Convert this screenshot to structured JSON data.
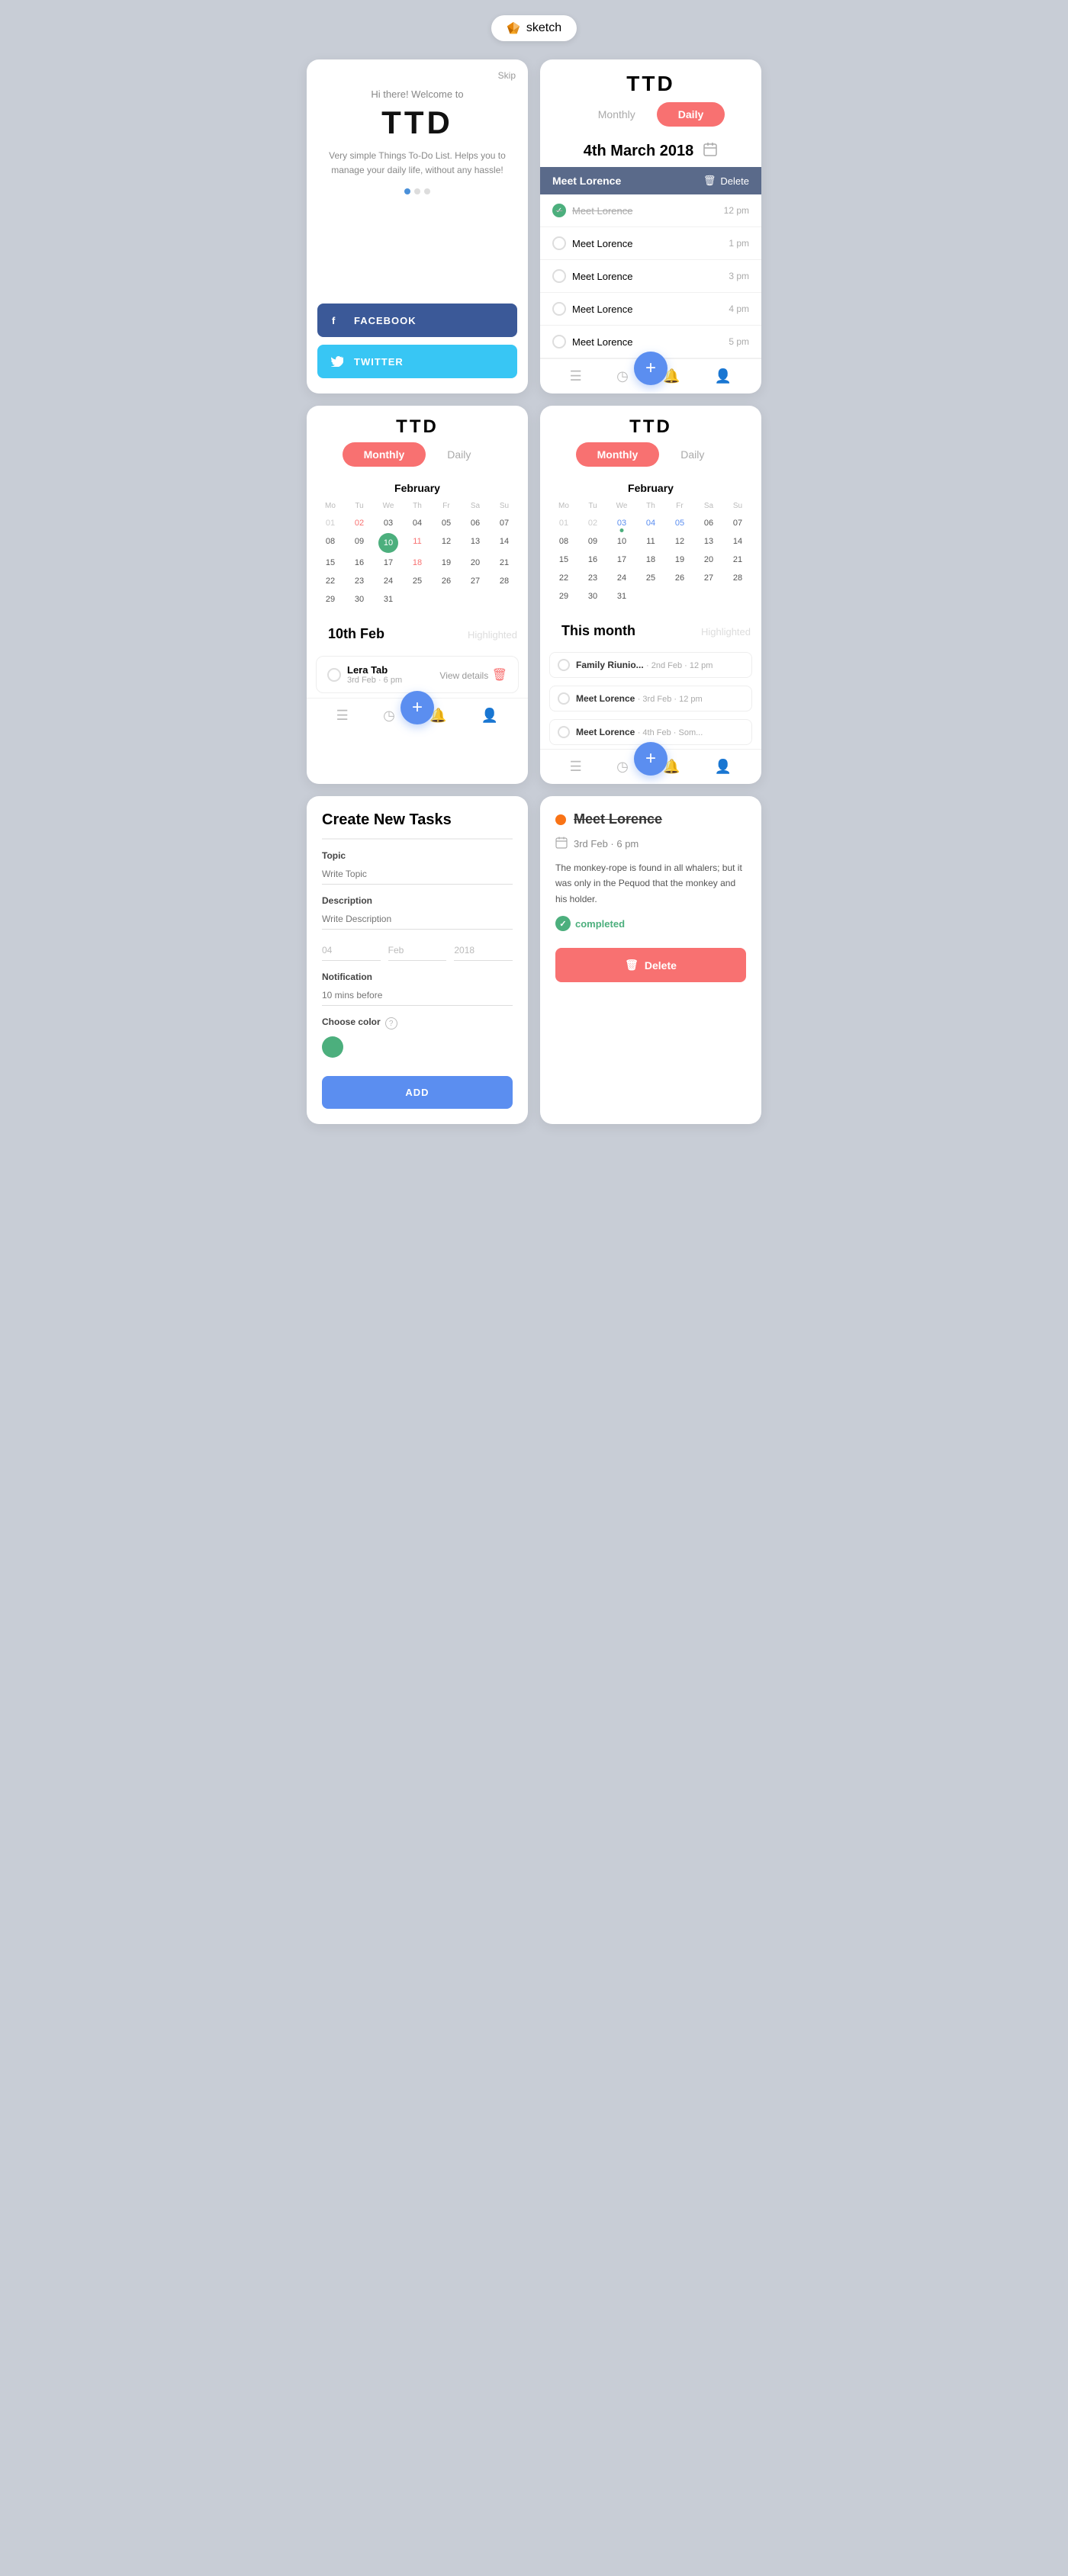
{
  "topbar": {
    "label": "sketch",
    "icon": "◆"
  },
  "card_welcome": {
    "skip_label": "Skip",
    "hi_text": "Hi there! Welcome to",
    "ttd_logo": "TTD",
    "desc": "Very simple Things To-Do List. Helps you to manage your daily life, without any hassle!",
    "dots": [
      true,
      false,
      false
    ],
    "facebook_label": "FACEBOOK",
    "twitter_label": "TWITTER"
  },
  "card_daily": {
    "ttd_logo": "TTD",
    "toggle_monthly": "Monthly",
    "toggle_daily": "Daily",
    "date": "4th March 2018",
    "header_task": "Meet Lorence",
    "delete_label": "Delete",
    "tasks": [
      {
        "name": "Meet Lorence",
        "time": "12 pm",
        "completed": true
      },
      {
        "name": "Meet Lorence",
        "time": "1 pm",
        "completed": false
      },
      {
        "name": "Meet Lorence",
        "time": "3 pm",
        "completed": false
      },
      {
        "name": "Meet Lorence",
        "time": "4 pm",
        "completed": false
      },
      {
        "name": "Meet Lorence",
        "time": "5 pm",
        "completed": false
      }
    ]
  },
  "card_calendar_left": {
    "ttd_logo": "TTD",
    "toggle_monthly": "Monthly",
    "toggle_daily": "Daily",
    "month_name": "February",
    "weekdays": [
      "Mo",
      "Tu",
      "We",
      "Th",
      "Fr",
      "Sa",
      "Su"
    ],
    "weeks": [
      [
        {
          "d": "01",
          "t": "gray"
        },
        {
          "d": "02",
          "t": "pink"
        },
        {
          "d": "03",
          "t": ""
        },
        {
          "d": "04",
          "t": ""
        },
        {
          "d": "05",
          "t": ""
        },
        {
          "d": "06",
          "t": ""
        },
        {
          "d": "07",
          "t": ""
        }
      ],
      [
        {
          "d": "08",
          "t": ""
        },
        {
          "d": "09",
          "t": ""
        },
        {
          "d": "10",
          "t": "today"
        },
        {
          "d": "11",
          "t": "pink"
        },
        {
          "d": "12",
          "t": ""
        },
        {
          "d": "13",
          "t": ""
        },
        {
          "d": "14",
          "t": ""
        }
      ],
      [
        {
          "d": "15",
          "t": ""
        },
        {
          "d": "16",
          "t": ""
        },
        {
          "d": "17",
          "t": ""
        },
        {
          "d": "18",
          "t": "pink"
        },
        {
          "d": "19",
          "t": ""
        },
        {
          "d": "20",
          "t": ""
        },
        {
          "d": "21",
          "t": ""
        }
      ],
      [
        {
          "d": "22",
          "t": ""
        },
        {
          "d": "23",
          "t": ""
        },
        {
          "d": "24",
          "t": ""
        },
        {
          "d": "25",
          "t": ""
        },
        {
          "d": "26",
          "t": ""
        },
        {
          "d": "27",
          "t": ""
        },
        {
          "d": "28",
          "t": ""
        }
      ],
      [
        {
          "d": "29",
          "t": ""
        },
        {
          "d": "30",
          "t": ""
        },
        {
          "d": "31",
          "t": ""
        }
      ]
    ],
    "selected_date": "10th Feb",
    "highlight_label": "Highlighted",
    "task_item": {
      "name": "Lera Tab",
      "meta": "3rd Feb · 6 pm"
    },
    "view_details": "View details"
  },
  "card_calendar_right": {
    "ttd_logo": "TTD",
    "toggle_monthly": "Monthly",
    "toggle_daily": "Daily",
    "month_name": "February",
    "weekdays": [
      "Mo",
      "Tu",
      "We",
      "Th",
      "Fr"
    ],
    "weeks": [
      [
        {
          "d": "01",
          "t": "gray"
        },
        {
          "d": "02",
          "t": "gray"
        },
        {
          "d": "03",
          "t": "blue has-dot"
        },
        {
          "d": "04",
          "t": "blue"
        },
        {
          "d": "05",
          "t": "blue"
        },
        {
          "d": "06",
          "t": ""
        },
        {
          "d": "07",
          "t": ""
        }
      ],
      [
        {
          "d": "08",
          "t": ""
        },
        {
          "d": "09",
          "t": ""
        },
        {
          "d": "10",
          "t": ""
        },
        {
          "d": "11",
          "t": ""
        },
        {
          "d": "12",
          "t": ""
        },
        {
          "d": "13",
          "t": ""
        },
        {
          "d": "14",
          "t": ""
        }
      ],
      [
        {
          "d": "15",
          "t": ""
        },
        {
          "d": "16",
          "t": ""
        },
        {
          "d": "17",
          "t": ""
        },
        {
          "d": "18",
          "t": ""
        },
        {
          "d": "19",
          "t": ""
        },
        {
          "d": "20",
          "t": ""
        },
        {
          "d": "21",
          "t": ""
        }
      ],
      [
        {
          "d": "22",
          "t": ""
        },
        {
          "d": "23",
          "t": ""
        },
        {
          "d": "24",
          "t": ""
        },
        {
          "d": "25",
          "t": ""
        },
        {
          "d": "26",
          "t": ""
        },
        {
          "d": "27",
          "t": ""
        },
        {
          "d": "28",
          "t": ""
        }
      ],
      [
        {
          "d": "29",
          "t": ""
        },
        {
          "d": "30",
          "t": ""
        },
        {
          "d": "31",
          "t": ""
        }
      ]
    ],
    "section_title": "This month",
    "highlight_label": "Highlighted",
    "month_tasks": [
      {
        "name": "Family Riunio...",
        "meta": "2nd Feb · 12 pm"
      },
      {
        "name": "Meet Lorence",
        "meta": "3rd Feb · 12 pm"
      },
      {
        "name": "Meet Lorence",
        "meta": "4th Feb · Som..."
      }
    ]
  },
  "card_create": {
    "title": "Create New Tasks",
    "topic_label": "Topic",
    "topic_placeholder": "Write Topic",
    "description_label": "Description",
    "description_placeholder": "Write Description",
    "date_day": "04",
    "date_month": "Feb",
    "date_year": "2018",
    "notification_label": "Notification",
    "notification_placeholder": "10 mins before",
    "choose_color_label": "Choose color",
    "add_label": "ADD"
  },
  "card_detail": {
    "task_name": "Meet Lorence",
    "date_meta": "3rd Feb · 6 pm",
    "description": "The monkey-rope is found in all whalers; but it was only in the Pequod that the monkey and his holder.",
    "completed_label": "completed",
    "delete_label": "Delete"
  },
  "icons": {
    "facebook": "f",
    "twitter": "t",
    "list": "☰",
    "clock": "◷",
    "bell": "🔔",
    "user": "👤",
    "calendar": "📅",
    "trash": "🗑",
    "plus": "+",
    "check": "✓",
    "question": "?",
    "cal_small": "📆"
  }
}
